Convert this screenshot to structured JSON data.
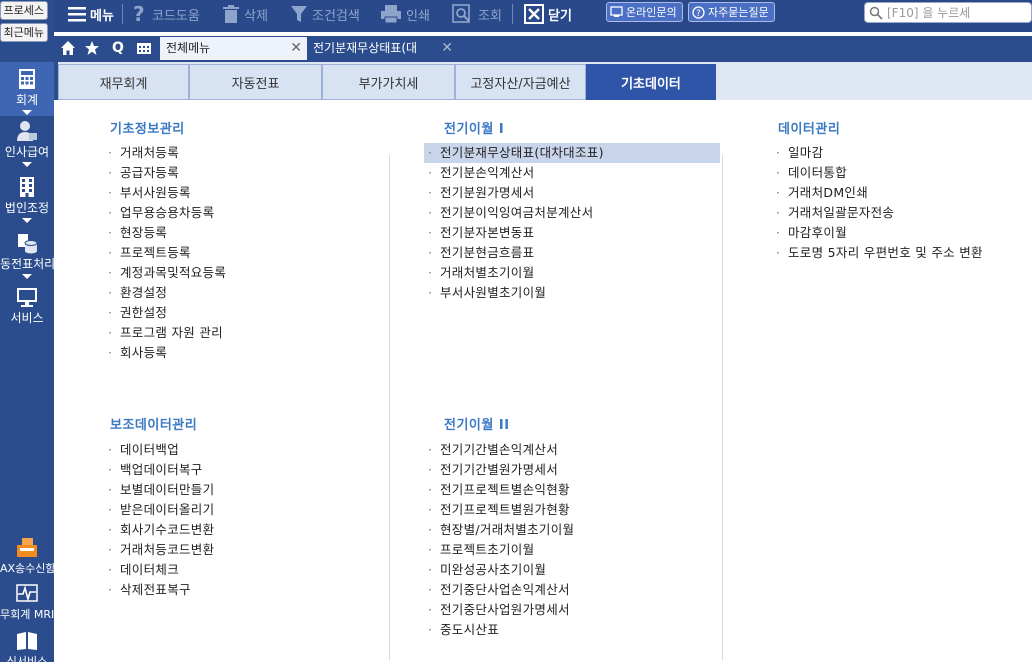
{
  "left": {
    "process_btn": "프로세스",
    "recent_btn": "최근메뉴",
    "nav": [
      {
        "label": "회계",
        "icon": "calculator-icon"
      },
      {
        "label": "인사급여",
        "icon": "person-icon"
      },
      {
        "label": "법인조정",
        "icon": "building-icon"
      },
      {
        "label": "동전표처리",
        "icon": "database-icon"
      },
      {
        "label": "서비스",
        "icon": "monitor-icon"
      }
    ],
    "bottom": [
      {
        "label": "AX송수신함",
        "icon": "fax-icon"
      },
      {
        "label": "무회계 MRI",
        "icon": "pulse-icon"
      },
      {
        "label": "식서비스",
        "icon": "book-icon"
      }
    ]
  },
  "toolbar": {
    "menu": "메뉴",
    "code_help": "코드도움",
    "delete": "삭제",
    "cond_search": "조건검색",
    "print": "인쇄",
    "inquiry": "조회",
    "close": "닫기",
    "online_inquiry": "온라인문의",
    "faq": "자주묻는질문",
    "search_placeholder": "[F10] 을 누르세"
  },
  "tabs": {
    "all_menu": "전체메뉴",
    "balance_sheet": "전기분재무상태표(대"
  },
  "categories": [
    "재무회계",
    "자동전표",
    "부가가치세",
    "고정자산/자금예산",
    "기초데이터"
  ],
  "groups": {
    "basic_info": {
      "title": "기초정보관리",
      "items": [
        "거래처등록",
        "공급자등록",
        "부서사원등록",
        "업무용승용차등록",
        "현장등록",
        "프로젝트등록",
        "계정과목및적요등록",
        "환경설정",
        "권한설정",
        "프로그램 자원 관리",
        "회사등록"
      ]
    },
    "prior_transfer_1": {
      "title": "전기이월 I",
      "items": [
        "전기분재무상태표(대차대조표)",
        "전기분손익계산서",
        "전기분원가명세서",
        "전기분이익잉여금처분계산서",
        "전기분자본변동표",
        "전기분현금흐름표",
        "거래처별초기이월",
        "부서사원별초기이월"
      ]
    },
    "data_mgmt": {
      "title": "데이터관리",
      "items": [
        "일마감",
        "데이터통합",
        "거래처DM인쇄",
        "거래처일괄문자전송",
        "마감후이월",
        "도로명 5자리 우편번호 및 주소 변환"
      ]
    },
    "aux_data": {
      "title": "보조데이터관리",
      "items": [
        "데이터백업",
        "백업데이터복구",
        "보별데이터만들기",
        "받은데이터올리기",
        "회사기수코드변환",
        "거래처등코드변환",
        "데이터체크",
        "삭제전표복구"
      ]
    },
    "prior_transfer_2": {
      "title": "전기이월 II",
      "items": [
        "전기기간별손익계산서",
        "전기기간별원가명세서",
        "전기프로젝트별손익현황",
        "전기프로젝트별원가현황",
        "현장별/거래처별초기이월",
        "프로젝트초기이월",
        "미완성공사초기이월",
        "전기중단사업손익계산서",
        "전기중단사업원가명세서",
        "중도시산표"
      ]
    }
  }
}
